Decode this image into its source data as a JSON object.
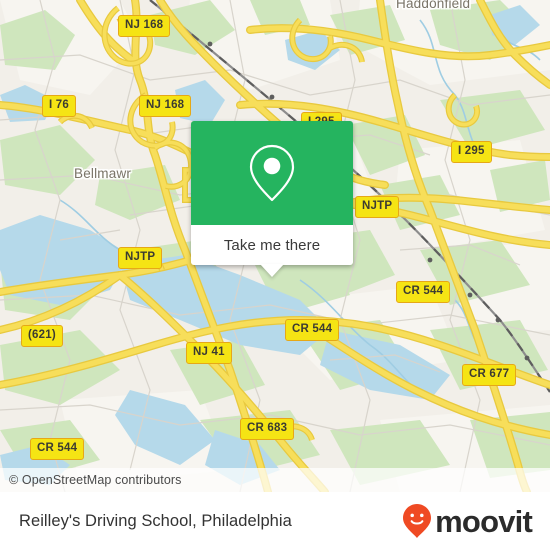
{
  "map": {
    "base_color": "#f2efe9",
    "water_color": "#b5d9ea",
    "park_color": "#cfe6bd",
    "road_color": "#f7de5a",
    "city_labels": [
      {
        "name": "Haddonfield",
        "text": "Haddonfield"
      },
      {
        "name": "Bellmawr",
        "text": "Bellmawr"
      }
    ],
    "road_shields": [
      {
        "id": "nj168-top",
        "text": "NJ 168"
      },
      {
        "id": "i76",
        "text": "I 76"
      },
      {
        "id": "nj168-mid",
        "text": "NJ 168"
      },
      {
        "id": "i295-top",
        "text": "I 295"
      },
      {
        "id": "i295-right",
        "text": "I 295"
      },
      {
        "id": "njtp-right",
        "text": "NJTP"
      },
      {
        "id": "njtp-left",
        "text": "NJTP"
      },
      {
        "id": "cr544-right",
        "text": "CR 544"
      },
      {
        "id": "cr544-mid",
        "text": "CR 544"
      },
      {
        "id": "cr677",
        "text": "CR 677"
      },
      {
        "id": "r621",
        "text": "(621)"
      },
      {
        "id": "nj41",
        "text": "NJ 41"
      },
      {
        "id": "cr683",
        "text": "CR 683"
      },
      {
        "id": "cr544-bottom",
        "text": "CR 544"
      }
    ],
    "attribution": "© OpenStreetMap contributors"
  },
  "popup": {
    "accent_color": "#25b45f",
    "pin_icon": "map-pin-icon",
    "action_label": "Take me there"
  },
  "footer": {
    "title": "Reilley's Driving School, Philadelphia",
    "brand_name": "moovit",
    "brand_color": "#ef4a23",
    "brand_pin_icon": "moovit-pin-icon"
  }
}
